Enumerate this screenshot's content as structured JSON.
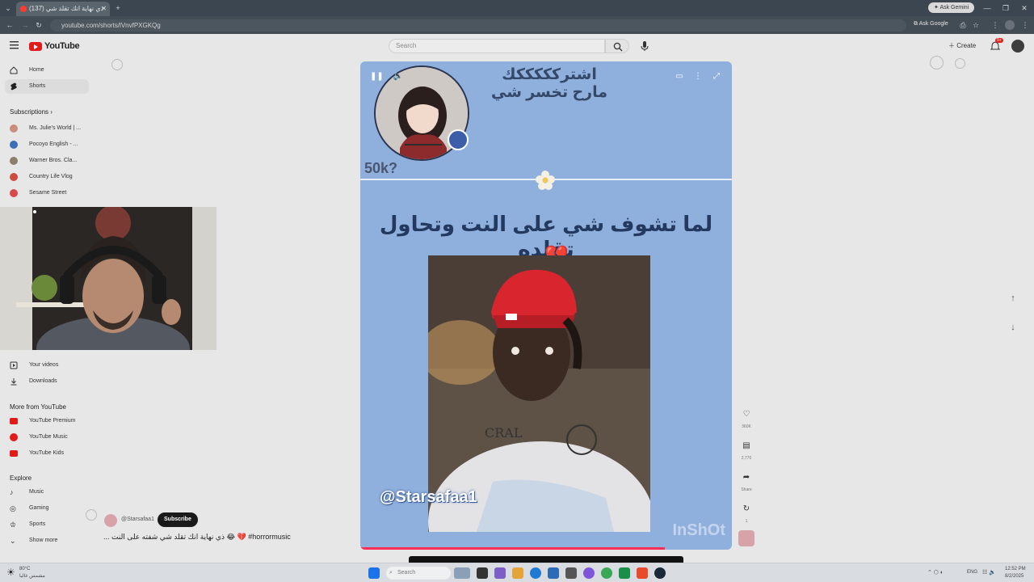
{
  "browser": {
    "tab_title": "(137) ذي نهاية انك تقلد شي",
    "url": "youtube.com/shorts/lVnvfPXGKQg",
    "ask_gemini": "Ask Gemini",
    "ask_google": "Ask Google"
  },
  "youtube": {
    "logo_text": "YouTube",
    "search_placeholder": "Search",
    "create_label": "Create",
    "notif_count": "9+"
  },
  "sidebar": {
    "main": [
      {
        "label": "Home",
        "icon": "home-icon"
      },
      {
        "label": "Shorts",
        "icon": "shorts-icon"
      }
    ],
    "subscriptions_title": "Subscriptions",
    "subscriptions": [
      {
        "label": "Ms. Julie's World | ...",
        "avatar_color": "#c98e7b"
      },
      {
        "label": "Pocoyo English - ...",
        "avatar_color": "#3b6fb6"
      },
      {
        "label": "Warner Bros. Cla...",
        "avatar_color": "#8a7f6a"
      },
      {
        "label": "Country Life Vlog",
        "avatar_color": "#cf4b3d"
      },
      {
        "label": "Sesame Street",
        "avatar_color": "#d84a4a"
      }
    ],
    "you_items": [
      {
        "label": "Your videos",
        "icon": "play-square-icon"
      },
      {
        "label": "Downloads",
        "icon": "download-icon"
      }
    ],
    "more_title": "More from YouTube",
    "more": [
      {
        "label": "YouTube Premium",
        "icon": "youtube-premium-icon"
      },
      {
        "label": "YouTube Music",
        "icon": "youtube-music-icon"
      },
      {
        "label": "YouTube Kids",
        "icon": "youtube-kids-icon"
      }
    ],
    "explore_title": "Explore",
    "explore": [
      {
        "label": "Music",
        "icon": "music-icon"
      },
      {
        "label": "Gaming",
        "icon": "gaming-icon"
      },
      {
        "label": "Sports",
        "icon": "trophy-icon"
      },
      {
        "label": "Show more",
        "icon": "chevron-down-icon"
      }
    ]
  },
  "short": {
    "top_text_line1": "اشتركككككك",
    "top_text_line2": "مارح تخسر شي",
    "count_badge": "50k?",
    "main_text": "لما تشوف شي على النت وتحاول تقلده",
    "handle": "@Starsafaa1",
    "watermark": "InShOt",
    "progress_fraction": 0.82
  },
  "actions": [
    {
      "label": "360K",
      "icon": "like-icon"
    },
    {
      "label": "2,770",
      "icon": "comment-icon"
    },
    {
      "label": "Share",
      "icon": "share-icon"
    },
    {
      "label": "1",
      "icon": "remix-icon"
    }
  ],
  "channel": {
    "name": "@Starsafaa1",
    "subscribe_label": "Subscribe",
    "caption": "... ذي نهاية انك تقلد شي شفته على النت 😂 💔 #horrormusic"
  },
  "taskbar": {
    "weather": "80°C",
    "weather_sub": "مشمس غالبا",
    "search_placeholder": "Search",
    "lang": "ENG",
    "time": "12:52 PM",
    "date": "8/2/2025"
  }
}
